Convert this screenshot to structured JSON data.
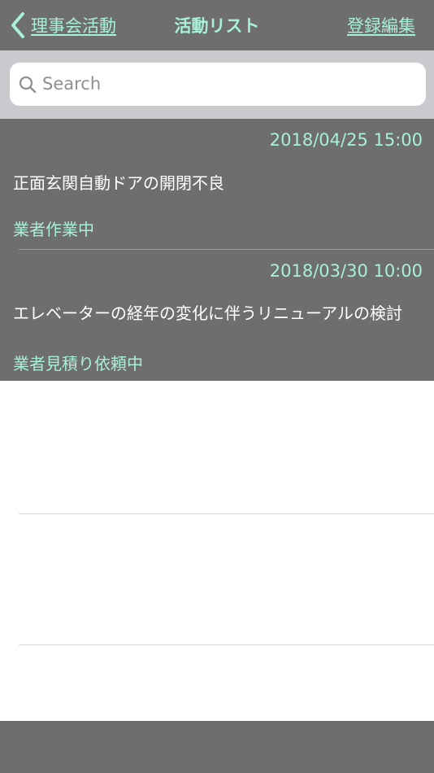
{
  "navbar": {
    "back_label": "理事会活動",
    "title": "活動リスト",
    "edit_label": "登録編集"
  },
  "search": {
    "placeholder": "Search",
    "value": ""
  },
  "activities": [
    {
      "datetime": "2018/04/25 15:00",
      "title": "正面玄関自動ドアの開閉不良",
      "status": "業者作業中"
    },
    {
      "datetime": "2018/03/30 10:00",
      "title": "エレベーターの経年の変化に伴うリニューアルの検討",
      "status": "業者見積り依頼中"
    }
  ],
  "colors": {
    "bar_background": "#6e6e6e",
    "accent": "#a8f0d6",
    "search_area_background": "#c9c9ce",
    "cell_text": "#ffffff"
  },
  "icons": {
    "back": "chevron-left-icon",
    "search": "magnifier-icon"
  }
}
